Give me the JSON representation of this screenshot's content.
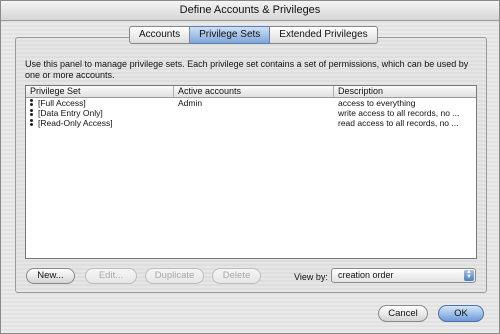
{
  "window": {
    "title": "Define Accounts & Privileges"
  },
  "tabs": [
    {
      "label": "Accounts"
    },
    {
      "label": "Privilege Sets"
    },
    {
      "label": "Extended Privileges"
    }
  ],
  "panel": {
    "instructions": "Use this panel to manage privilege sets.  Each privilege set contains a set of permissions, which can be used by one or more accounts."
  },
  "table": {
    "columns": [
      "Privilege Set",
      "Active accounts",
      "Description"
    ],
    "rows": [
      {
        "name": "[Full Access]",
        "accounts": "Admin",
        "description": "access to everything"
      },
      {
        "name": "[Data Entry Only]",
        "accounts": "",
        "description": "write access to all records, no ..."
      },
      {
        "name": "[Read-Only Access]",
        "accounts": "",
        "description": "read access to all records, no ..."
      }
    ]
  },
  "actions": {
    "new": "New...",
    "edit": "Edit...",
    "duplicate": "Duplicate",
    "delete": "Delete"
  },
  "view_by": {
    "label": "View by:",
    "selected": "creation order"
  },
  "footer": {
    "cancel": "Cancel",
    "ok": "OK"
  },
  "icons": {
    "grip": "drag-handle-icon",
    "select_arrows": "updown-arrows-icon"
  }
}
